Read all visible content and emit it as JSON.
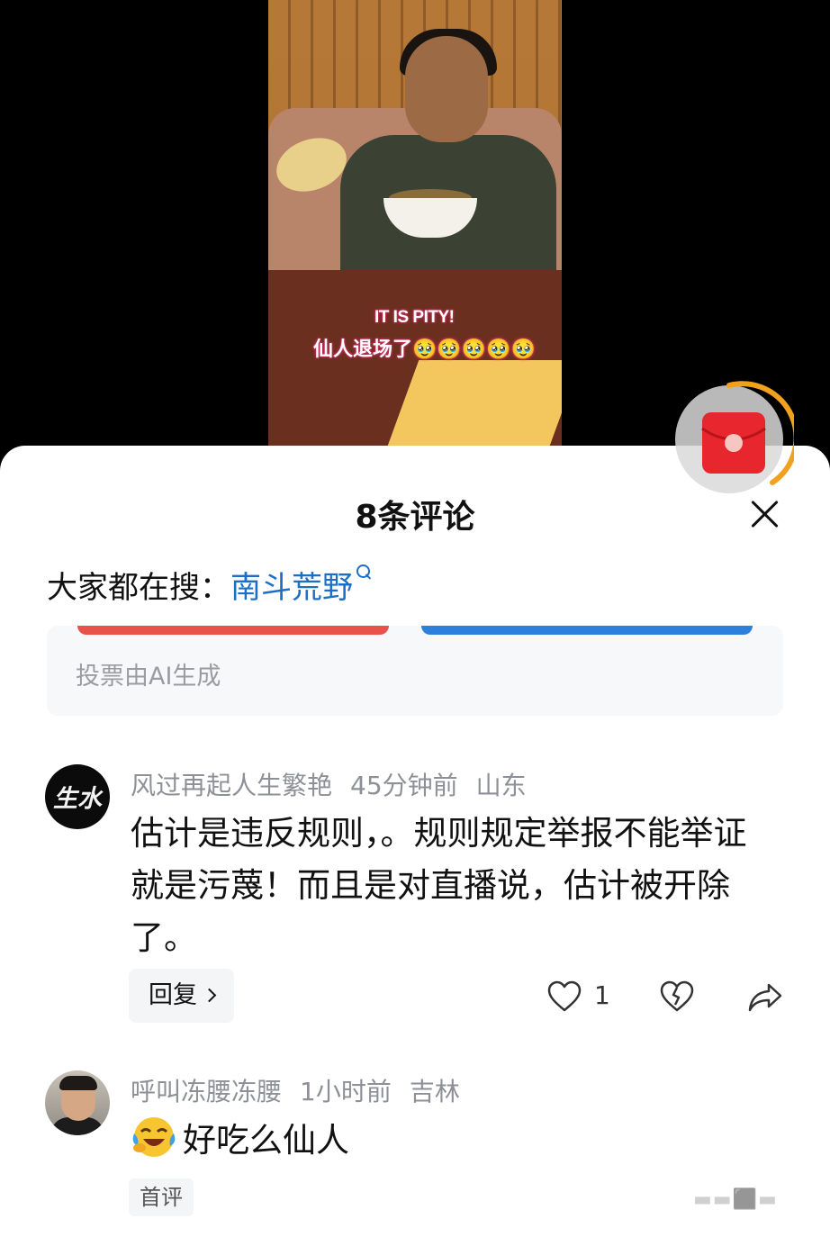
{
  "video": {
    "overlay_en": "IT IS PITY!",
    "overlay_zh": "仙人退场了🥹🥹🥹🥹🥹"
  },
  "sheet": {
    "title": "8条评论",
    "search_prefix": "大家都在搜：",
    "search_term": "南斗荒野",
    "vote_note": "投票由AI生成"
  },
  "comments": [
    {
      "avatar_text": "生水",
      "user": "风过再起人生繁艳",
      "time": "45分钟前",
      "location": "山东",
      "text": "估计是违反规则，。规则规定举报不能举证就是污蔑！而且是对直播说，估计被开除了。",
      "reply_label": "回复",
      "likes": "1"
    },
    {
      "user": "呼叫冻腰冻腰",
      "time": "1小时前",
      "location": "吉林",
      "text": "好吃么仙人",
      "tag": "首评"
    }
  ],
  "colors": {
    "accent_blue": "#1e6fc3",
    "vote_red": "#e9524a",
    "vote_blue": "#2d7fdc",
    "redpack_red": "#e8262e",
    "ring_orange": "#f2a11f"
  }
}
